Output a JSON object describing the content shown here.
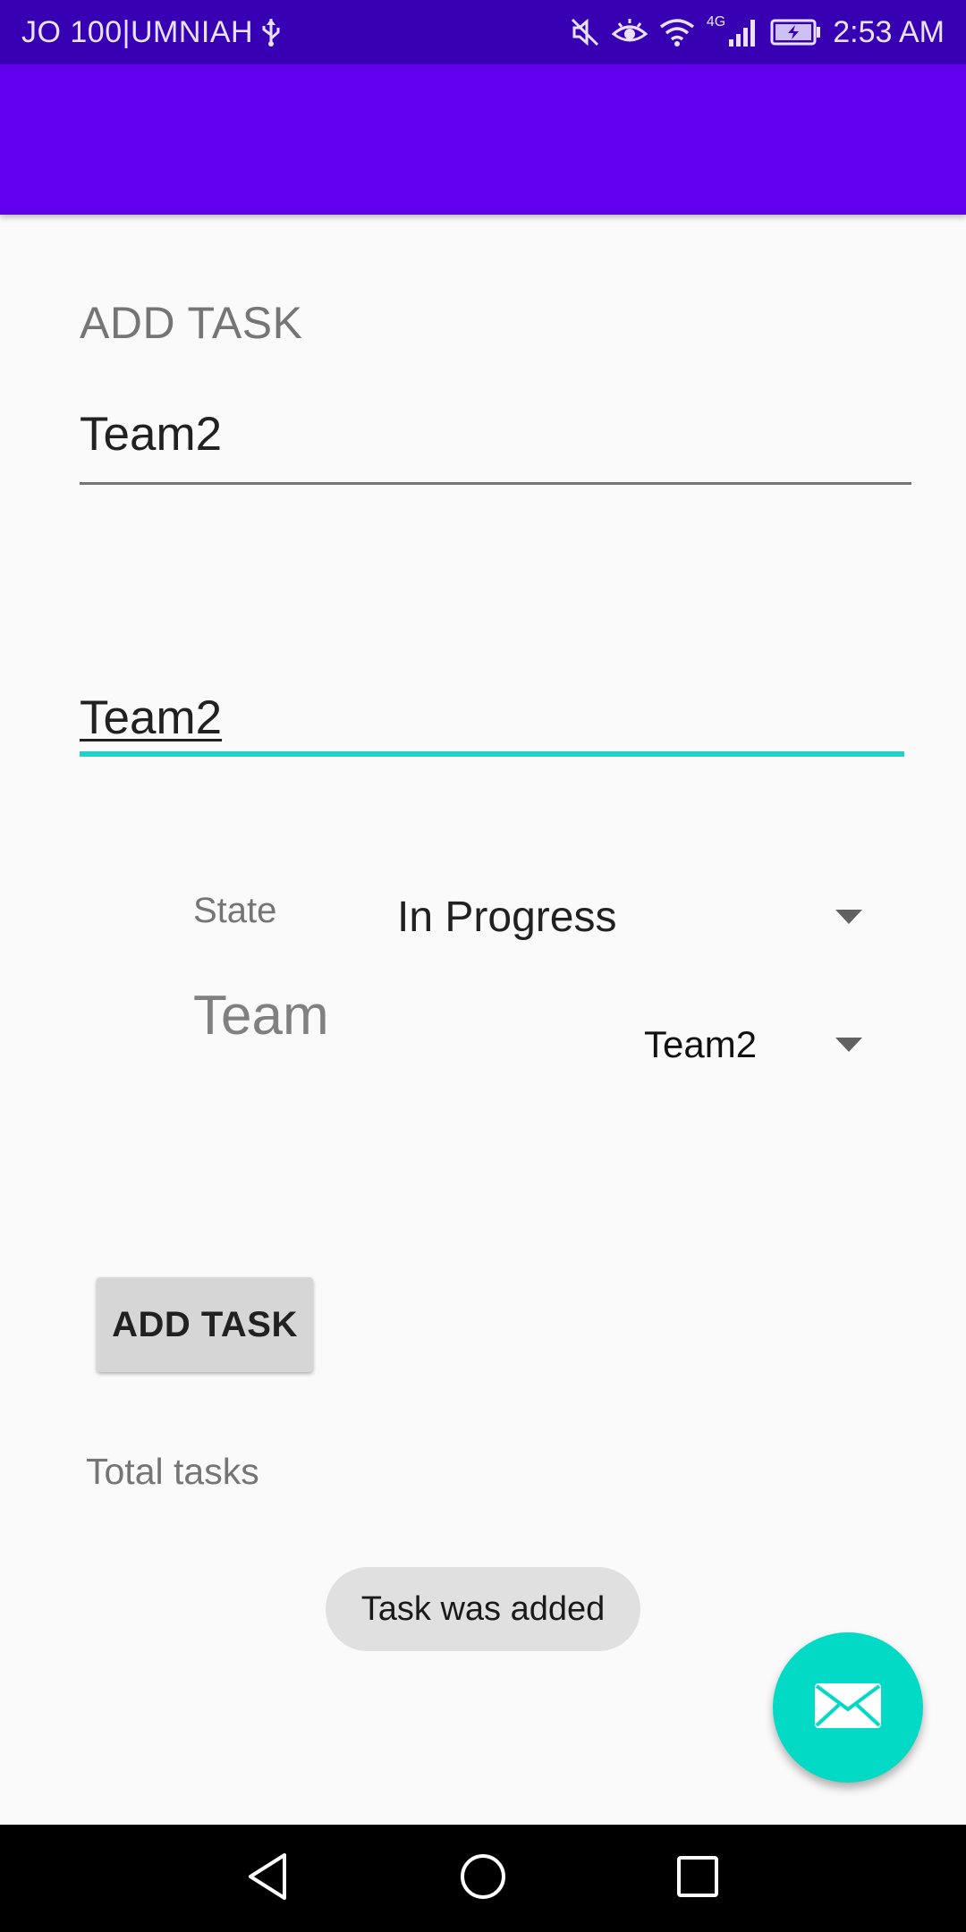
{
  "status_bar": {
    "carrier": "JO 100|UMNIAH",
    "time": "2:53 AM",
    "network_type": "4G",
    "icons": [
      "usb-icon",
      "mute-icon",
      "eye-comfort-icon",
      "wifi-icon",
      "signal-icon",
      "battery-charging-icon"
    ]
  },
  "colors": {
    "status_bar": "#3700b3",
    "app_bar": "#6200ee",
    "accent": "#03dac5",
    "focused_underline": "#26d0c3"
  },
  "form": {
    "heading": "ADD TASK",
    "title_field": {
      "value": "Team2"
    },
    "description_field": {
      "value": "Team2"
    },
    "state_label": "State",
    "state_spinner": {
      "selected": "In Progress"
    },
    "team_label": "Team",
    "team_spinner": {
      "selected": "Team2"
    },
    "submit_label": "ADD TASK",
    "total_label": "Total tasks"
  },
  "toast": {
    "message": "Task was added"
  },
  "fab": {
    "icon": "mail-icon"
  },
  "nav_bar": {
    "icons": [
      "back-icon",
      "home-icon",
      "recents-icon"
    ]
  }
}
